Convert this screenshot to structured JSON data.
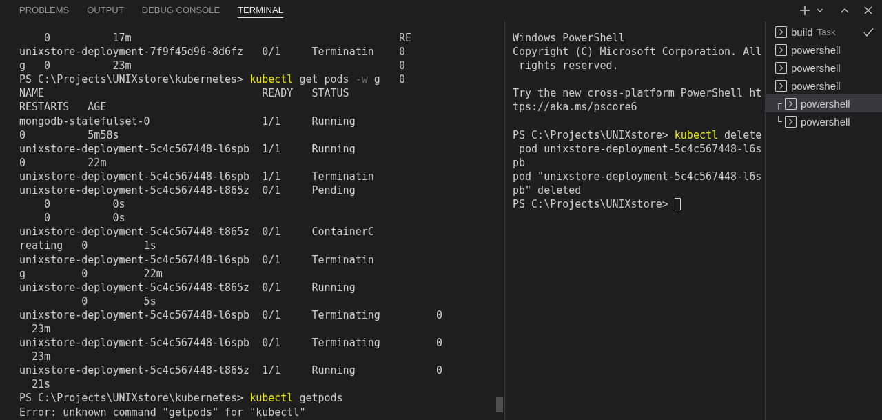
{
  "tabs": [
    {
      "label": "PROBLEMS",
      "selected": false
    },
    {
      "label": "OUTPUT",
      "selected": false
    },
    {
      "label": "DEBUG CONSOLE",
      "selected": false
    },
    {
      "label": "TERMINAL",
      "selected": true
    }
  ],
  "left_terminal": {
    "lines": [
      [
        {
          "kind": "output",
          "text": "    0          17m                                           RE"
        }
      ],
      [
        {
          "kind": "output",
          "text": "unixstore-deployment-7f9f45d96-8d6fz   0/1     Terminatin    0"
        }
      ],
      [
        {
          "kind": "output",
          "text": "g   0          23m                                           0"
        }
      ],
      [
        {
          "kind": "output",
          "text": "PS C:\\Projects\\UNIXstore\\kubernetes> "
        },
        {
          "kind": "command",
          "text": "kubectl"
        },
        {
          "kind": "output",
          "text": " get pods "
        },
        {
          "kind": "flag",
          "text": "-w"
        },
        {
          "kind": "output",
          "text": " g   0"
        }
      ],
      [
        {
          "kind": "output",
          "text": "NAME                                   READY   STATUS"
        }
      ],
      [
        {
          "kind": "output",
          "text": "RESTARTS   AGE"
        }
      ],
      [
        {
          "kind": "output",
          "text": "mongodb-statefulset-0                  1/1     Running"
        }
      ],
      [
        {
          "kind": "output",
          "text": "0          5m58s"
        }
      ],
      [
        {
          "kind": "output",
          "text": "unixstore-deployment-5c4c567448-l6spb  1/1     Running"
        }
      ],
      [
        {
          "kind": "output",
          "text": "0          22m"
        }
      ],
      [
        {
          "kind": "output",
          "text": "unixstore-deployment-5c4c567448-l6spb  1/1     Terminatin"
        }
      ],
      [
        {
          "kind": "output",
          "text": "unixstore-deployment-5c4c567448-t865z  0/1     Pending"
        }
      ],
      [
        {
          "kind": "output",
          "text": "    0          0s"
        }
      ],
      [
        {
          "kind": "output",
          "text": "    0          0s"
        }
      ],
      [
        {
          "kind": "output",
          "text": "unixstore-deployment-5c4c567448-t865z  0/1     ContainerC"
        }
      ],
      [
        {
          "kind": "output",
          "text": "reating   0         1s"
        }
      ],
      [
        {
          "kind": "output",
          "text": "unixstore-deployment-5c4c567448-l6spb  0/1     Terminatin"
        }
      ],
      [
        {
          "kind": "output",
          "text": "g         0         22m"
        }
      ],
      [
        {
          "kind": "output",
          "text": "unixstore-deployment-5c4c567448-t865z  0/1     Running"
        }
      ],
      [
        {
          "kind": "output",
          "text": "          0         5s"
        }
      ],
      [
        {
          "kind": "output",
          "text": "unixstore-deployment-5c4c567448-l6spb  0/1     Terminating         0"
        }
      ],
      [
        {
          "kind": "output",
          "text": "  23m"
        }
      ],
      [
        {
          "kind": "output",
          "text": "unixstore-deployment-5c4c567448-l6spb  0/1     Terminating         0"
        }
      ],
      [
        {
          "kind": "output",
          "text": "  23m"
        }
      ],
      [
        {
          "kind": "output",
          "text": "unixstore-deployment-5c4c567448-t865z  1/1     Running             0"
        }
      ],
      [
        {
          "kind": "output",
          "text": "  21s"
        }
      ],
      [
        {
          "kind": "output",
          "text": "PS C:\\Projects\\UNIXstore\\kubernetes> "
        },
        {
          "kind": "command",
          "text": "kubectl"
        },
        {
          "kind": "output",
          "text": " getpods"
        }
      ],
      [
        {
          "kind": "output",
          "text": "Error: unknown command \"getpods\" for \"kubectl\""
        }
      ]
    ]
  },
  "right_terminal": {
    "blocks": [
      [
        [
          {
            "kind": "output",
            "text": "Windows PowerShell"
          }
        ],
        [
          {
            "kind": "output",
            "text": "Copyright (C) Microsoft Corporation. All"
          }
        ],
        [
          {
            "kind": "output",
            "text": " rights reserved."
          }
        ]
      ],
      [
        [
          {
            "kind": "output",
            "text": "Try the new cross-platform PowerShell ht"
          }
        ],
        [
          {
            "kind": "output",
            "text": "tps://aka.ms/pscore6"
          }
        ]
      ],
      [
        [
          {
            "kind": "output",
            "text": "PS C:\\Projects\\UNIXstore> "
          },
          {
            "kind": "command",
            "text": "kubectl"
          },
          {
            "kind": "output",
            "text": " delete"
          }
        ],
        [
          {
            "kind": "output",
            "text": " pod unixstore-deployment-5c4c567448-l6s"
          }
        ],
        [
          {
            "kind": "output",
            "text": "pb"
          }
        ],
        [
          {
            "kind": "output",
            "text": "pod \"unixstore-deployment-5c4c567448-l6s"
          }
        ],
        [
          {
            "kind": "output",
            "text": "pb\" deleted"
          }
        ],
        [
          {
            "kind": "output",
            "text": "PS C:\\Projects\\UNIXstore> "
          },
          {
            "kind": "cursor"
          }
        ]
      ]
    ]
  },
  "terminal_list": [
    {
      "name": "build",
      "detail": "Task",
      "done": true,
      "selected": false
    },
    {
      "name": "powershell",
      "done": false,
      "selected": false
    },
    {
      "name": "powershell",
      "done": false,
      "selected": false
    },
    {
      "name": "powershell",
      "done": false,
      "selected": false
    },
    {
      "name": "powershell",
      "tree_mark": "┌",
      "done": false,
      "selected": true
    },
    {
      "name": "powershell",
      "tree_mark": "└",
      "done": false,
      "selected": false
    }
  ]
}
